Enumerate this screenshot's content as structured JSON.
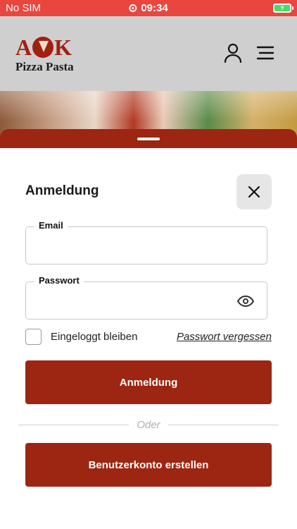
{
  "status_bar": {
    "carrier": "No SIM",
    "time": "09:34",
    "battery_color": "#4cd964"
  },
  "header": {
    "logo_top": "AOK",
    "logo_sub": "Pizza Pasta",
    "user_icon": "user-icon",
    "menu_icon": "menu-icon",
    "brand_color": "#9c2612"
  },
  "login": {
    "title": "Anmeldung",
    "close_icon": "close-icon",
    "email": {
      "label": "Email",
      "value": "",
      "placeholder": ""
    },
    "password": {
      "label": "Passwort",
      "value": "",
      "placeholder": "",
      "toggle_icon": "eye-icon"
    },
    "remember_label": "Eingeloggt bleiben",
    "remember_checked": false,
    "forgot_link": "Passwort vergessen",
    "submit_label": "Anmeldung",
    "divider_text": "Oder",
    "register_label": "Benutzerkonto erstellen"
  }
}
